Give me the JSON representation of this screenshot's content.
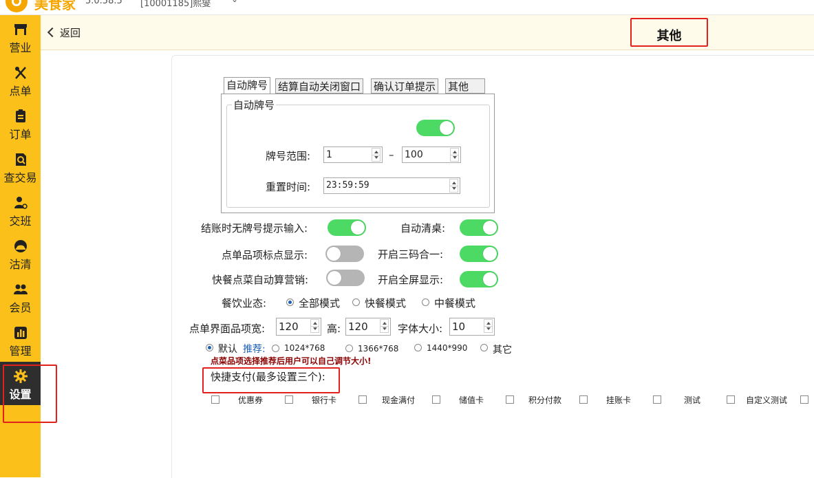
{
  "app": {
    "name": "美食家",
    "version": "5.0.58.5",
    "store": "[10001185]熙燮",
    "brand_color": "#fbc11a"
  },
  "sidebar": {
    "items": [
      {
        "label": "营业",
        "icon": "storefront-icon"
      },
      {
        "label": "点单",
        "icon": "fork-knife-icon"
      },
      {
        "label": "订单",
        "icon": "clipboard-icon"
      },
      {
        "label": "查交易",
        "icon": "search-document-icon"
      },
      {
        "label": "交班",
        "icon": "user-shift-icon"
      },
      {
        "label": "沽清",
        "icon": "cloche-icon"
      },
      {
        "label": "会员",
        "icon": "members-icon"
      },
      {
        "label": "管理",
        "icon": "bar-chart-icon"
      },
      {
        "label": "设置",
        "icon": "gear-icon",
        "active": true
      }
    ]
  },
  "header": {
    "back_label": "返回",
    "title": "其他"
  },
  "tabs": [
    {
      "label": "自动牌号",
      "active": true
    },
    {
      "label": "结算自动关闭窗口"
    },
    {
      "label": "确认订单提示"
    },
    {
      "label": "其他"
    }
  ],
  "auto_number": {
    "group_title": "自动牌号",
    "enabled": true,
    "range_label": "牌号范围:",
    "range_from": "1",
    "range_sep": "–",
    "range_to": "100",
    "reset_label": "重置时间:",
    "reset_time": "23:59:59"
  },
  "options": {
    "checkout_no_number_prompt": {
      "label": "结账时无牌号提示输入:",
      "on": true
    },
    "auto_clear_table": {
      "label": "自动清桌:",
      "on": true
    },
    "order_item_badge": {
      "label": "点单品项标点显示:",
      "on": false
    },
    "three_codes": {
      "label": "开启三码合一:",
      "on": true
    },
    "fast_food_marketing": {
      "label": "快餐点菜自动算营销:",
      "on": false
    },
    "fullscreen": {
      "label": "开启全屏显示:",
      "on": true
    }
  },
  "business_mode": {
    "label": "餐饮业态:",
    "options": [
      "全部模式",
      "快餐模式",
      "中餐模式"
    ],
    "selected": "全部模式"
  },
  "item_size": {
    "width_label": "点单界面品项宽:",
    "width": "120",
    "height_label": "高:",
    "height": "120",
    "font_label": "字体大小:",
    "font_size": "10"
  },
  "resolution": {
    "default_label": "默认",
    "recommend_label": "推荐:",
    "options": [
      "1024*768",
      "1366*768",
      "1440*990",
      "其它"
    ],
    "selected": "默认"
  },
  "hint": "点菜品项选择推荐后用户可以自己调节大小!",
  "quick_pay": {
    "title": "快捷支付(最多设置三个):",
    "methods": [
      "优惠券",
      "银行卡",
      "现金满付",
      "储值卡",
      "积分付款",
      "挂账卡",
      "测试",
      "自定义测试"
    ]
  },
  "colors": {
    "toggle_on": "#4cd964",
    "toggle_off": "#b5b5b5",
    "highlight_box": "#e2211c",
    "header_bg": "#fffbea",
    "hint_text": "#8b0000"
  }
}
